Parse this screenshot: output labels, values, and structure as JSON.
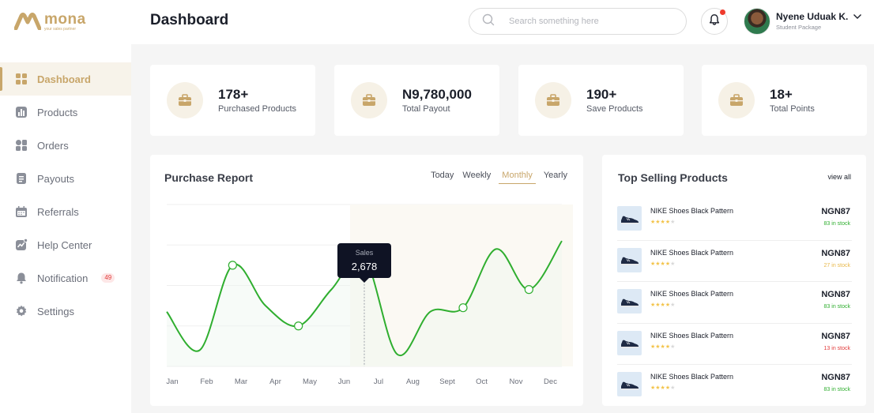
{
  "brand": {
    "name": "mona",
    "tagline": "your sales partner"
  },
  "header": {
    "title": "Dashboard",
    "search_placeholder": "Search something here",
    "user_name": "Nyene Uduak K.",
    "user_role": "Student Package"
  },
  "sidebar": {
    "items": [
      {
        "label": "Dashboard",
        "icon": "grid-icon",
        "active": true
      },
      {
        "label": "Products",
        "icon": "bar-chart-icon"
      },
      {
        "label": "Orders",
        "icon": "orders-icon"
      },
      {
        "label": "Payouts",
        "icon": "document-icon"
      },
      {
        "label": "Referrals",
        "icon": "calendar-icon"
      },
      {
        "label": "Help Center",
        "icon": "trend-icon"
      },
      {
        "label": "Notification",
        "icon": "bell-icon",
        "badge": "49"
      },
      {
        "label": "Settings",
        "icon": "gear-icon"
      }
    ]
  },
  "stats": [
    {
      "value": "178+",
      "label": "Purchased Products"
    },
    {
      "value": "N9,780,000",
      "label": "Total Payout"
    },
    {
      "value": "190+",
      "label": "Save Products"
    },
    {
      "value": "18+",
      "label": "Total Points"
    }
  ],
  "report": {
    "title": "Purchase Report",
    "periods": [
      "Today",
      "Weekly",
      "Monthly",
      "Yearly"
    ],
    "active_period": "Monthly",
    "tooltip_label": "Sales",
    "tooltip_value": "2,678"
  },
  "chart_data": {
    "type": "line",
    "title": "Purchase Report",
    "categories": [
      "Jan",
      "Feb",
      "Mar",
      "Apr",
      "May",
      "Jun",
      "Jul",
      "Aug",
      "Sept",
      "Oct",
      "Nov",
      "Dec"
    ],
    "values": [
      1350,
      400,
      2500,
      1500,
      1000,
      1900,
      2678,
      300,
      1350,
      1450,
      2900,
      1900,
      3100
    ],
    "ylim": [
      0,
      4000
    ],
    "grid": true,
    "highlight_category": "Jul",
    "color": "#2fae2f"
  },
  "top_selling": {
    "title": "Top Selling Products",
    "view_all": "view all",
    "products": [
      {
        "name": "NIKE Shoes Black Pattern",
        "price": "NGN87",
        "stock": "83 in stock",
        "stock_color": "#2fae2f",
        "rating": 4
      },
      {
        "name": "NIKE Shoes Black Pattern",
        "price": "NGN87",
        "stock": "27 in stock",
        "stock_color": "#e8b84a",
        "rating": 4
      },
      {
        "name": "NIKE Shoes Black Pattern",
        "price": "NGN87",
        "stock": "83 in stock",
        "stock_color": "#2fae2f",
        "rating": 4
      },
      {
        "name": "NIKE Shoes Black Pattern",
        "price": "NGN87",
        "stock": "13 in stock",
        "stock_color": "#e23a3a",
        "rating": 4
      },
      {
        "name": "NIKE Shoes Black Pattern",
        "price": "NGN87",
        "stock": "83 in stock",
        "stock_color": "#2fae2f",
        "rating": 4
      }
    ]
  },
  "colors": {
    "accent": "#c8a66a",
    "line": "#2fae2f"
  }
}
